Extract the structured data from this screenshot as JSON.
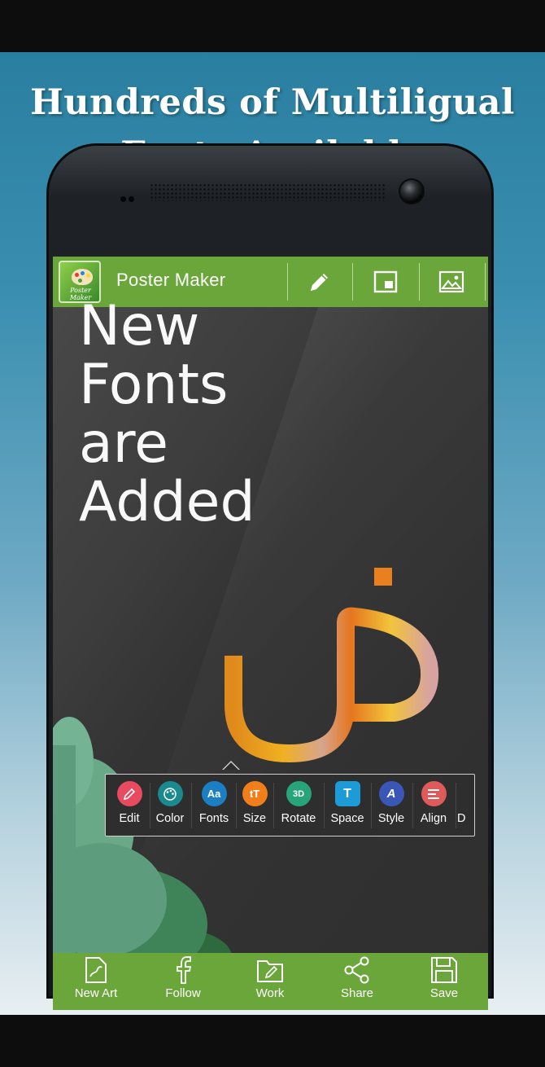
{
  "promo": {
    "headline_line1": "Hundreds of Multiligual",
    "headline_line2": "Fonts Available"
  },
  "app_bar": {
    "title": "Poster Maker",
    "logo_text": "Poster Maker",
    "actions": [
      {
        "icon": "pencil-icon"
      },
      {
        "icon": "picture-in-picture-icon"
      },
      {
        "icon": "image-icon"
      }
    ],
    "color": "#6aa63a"
  },
  "poster": {
    "lines": [
      "New",
      "Fonts",
      "are",
      "Added"
    ],
    "arabic_letter": "ض",
    "background": "#333333"
  },
  "text_toolbar": {
    "tools": [
      {
        "label": "Edit",
        "icon": "pencil-icon",
        "color": "#e84a5f"
      },
      {
        "label": "Color",
        "icon": "palette-icon",
        "color": "#1a8a8f"
      },
      {
        "label": "Fonts",
        "icon": "font-aa-icon",
        "glyph": "Aa",
        "color": "#1c7fc4"
      },
      {
        "label": "Size",
        "icon": "text-size-icon",
        "glyph": "tT",
        "color": "#f07f1b"
      },
      {
        "label": "Rotate",
        "icon": "rotate-3d-icon",
        "glyph": "3D",
        "color": "#27a47a"
      },
      {
        "label": "Space",
        "icon": "text-spacing-icon",
        "glyph": "T",
        "color": "#1d9bd7"
      },
      {
        "label": "Style",
        "icon": "text-style-icon",
        "glyph": "A",
        "color": "#3a57b8"
      },
      {
        "label": "Align",
        "icon": "align-left-icon",
        "color": "#e05a5a"
      },
      {
        "label": "D",
        "icon": "partial-tool-icon",
        "color": "#555555"
      }
    ]
  },
  "bottom_nav": {
    "items": [
      {
        "label": "New Art",
        "icon": "new-art-icon"
      },
      {
        "label": "Follow",
        "icon": "facebook-icon"
      },
      {
        "label": "Work",
        "icon": "folder-edit-icon"
      },
      {
        "label": "Share",
        "icon": "share-icon"
      },
      {
        "label": "Save",
        "icon": "save-icon"
      }
    ],
    "color": "#6aa63a"
  }
}
